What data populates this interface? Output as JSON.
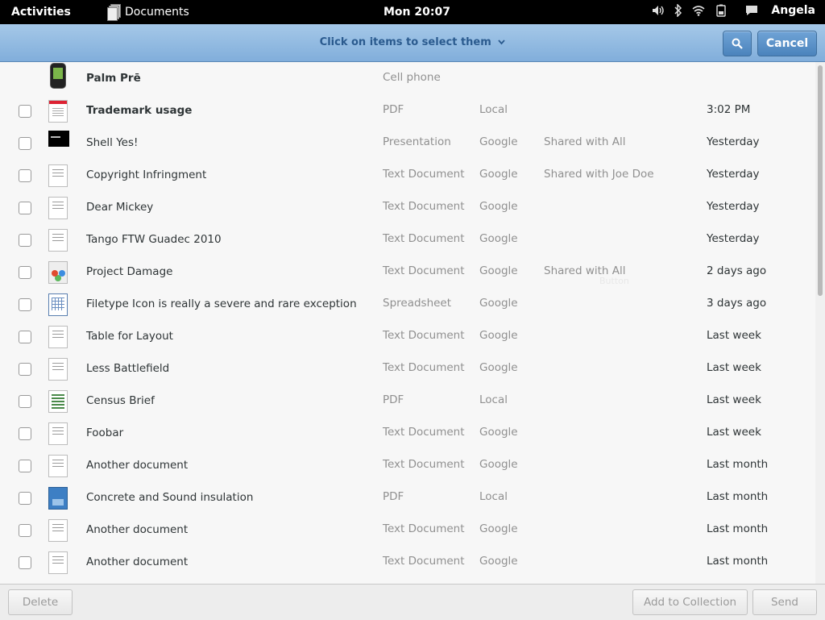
{
  "panel": {
    "activities": "Activities",
    "app_name": "Documents",
    "clock": "Mon 20:07",
    "user": "Angela",
    "status_icons": [
      "volume-icon",
      "bluetooth-icon",
      "wifi-icon",
      "battery-icon",
      "chat-icon"
    ]
  },
  "header": {
    "select_title": "Click on items to select them",
    "chevron": "⌄",
    "cancel_label": "Cancel",
    "search_icon": "search-icon"
  },
  "rows": [
    {
      "title": "Palm Prē",
      "type": "Cell phone",
      "source": "",
      "shared": "",
      "date": "",
      "thumb": "phone",
      "bold": true,
      "checkbox": false
    },
    {
      "title": "Trademark usage",
      "type": "PDF",
      "source": "Local",
      "shared": "",
      "date": "3:02 PM",
      "thumb": "pdf",
      "bold": true,
      "checkbox": true
    },
    {
      "title": "Shell Yes!",
      "type": "Presentation",
      "source": "Google",
      "shared": "Shared with All",
      "date": "Yesterday",
      "thumb": "pres",
      "bold": false,
      "checkbox": true
    },
    {
      "title": "Copyright Infringment",
      "type": "Text Document",
      "source": "Google",
      "shared": "Shared with Joe Doe",
      "date": "Yesterday",
      "thumb": "doc",
      "bold": false,
      "checkbox": true
    },
    {
      "title": "Dear Mickey",
      "type": "Text Document",
      "source": "Google",
      "shared": "",
      "date": "Yesterday",
      "thumb": "doc",
      "bold": false,
      "checkbox": true
    },
    {
      "title": "Tango FTW Guadec 2010",
      "type": "Text Document",
      "source": "Google",
      "shared": "",
      "date": "Yesterday",
      "thumb": "doc",
      "bold": false,
      "checkbox": true
    },
    {
      "title": "Project Damage",
      "type": "Text Document",
      "source": "Google",
      "shared": "Shared with All",
      "date": "2 days ago",
      "thumb": "colorful",
      "bold": false,
      "checkbox": true
    },
    {
      "title": "Filetype Icon is really a severe and rare exception",
      "type": "Spreadsheet",
      "source": "Google",
      "shared": "",
      "date": "3 days ago",
      "thumb": "sheet",
      "bold": false,
      "checkbox": true
    },
    {
      "title": "Table for Layout",
      "type": "Text Document",
      "source": "Google",
      "shared": "",
      "date": "Last week",
      "thumb": "doc",
      "bold": false,
      "checkbox": true
    },
    {
      "title": "Less Battlefield",
      "type": "Text Document",
      "source": "Google",
      "shared": "",
      "date": "Last week",
      "thumb": "doc",
      "bold": false,
      "checkbox": true
    },
    {
      "title": "Census Brief",
      "type": "PDF",
      "source": "Local",
      "shared": "",
      "date": "Last week",
      "thumb": "census",
      "bold": false,
      "checkbox": true
    },
    {
      "title": "Foobar",
      "type": "Text Document",
      "source": "Google",
      "shared": "",
      "date": "Last week",
      "thumb": "doc",
      "bold": false,
      "checkbox": true
    },
    {
      "title": "Another document",
      "type": "Text Document",
      "source": "Google",
      "shared": "",
      "date": "Last month",
      "thumb": "doc",
      "bold": false,
      "checkbox": true
    },
    {
      "title": "Concrete and Sound insulation",
      "type": "PDF",
      "source": "Local",
      "shared": "",
      "date": "Last month",
      "thumb": "blue",
      "bold": false,
      "checkbox": true
    },
    {
      "title": "Another document",
      "type": "Text Document",
      "source": "Google",
      "shared": "",
      "date": "Last month",
      "thumb": "doc",
      "bold": false,
      "checkbox": true
    },
    {
      "title": "Another document",
      "type": "Text Document",
      "source": "Google",
      "shared": "",
      "date": "Last month",
      "thumb": "doc",
      "bold": false,
      "checkbox": true
    }
  ],
  "ghost_text": "Button",
  "footer": {
    "delete_label": "Delete",
    "add_collection_label": "Add to Collection",
    "send_label": "Send"
  },
  "colors": {
    "header_top": "#a5c8e8",
    "header_bottom": "#81aedb",
    "title_blue": "#2a5a8e",
    "secondary_text": "#909090"
  }
}
